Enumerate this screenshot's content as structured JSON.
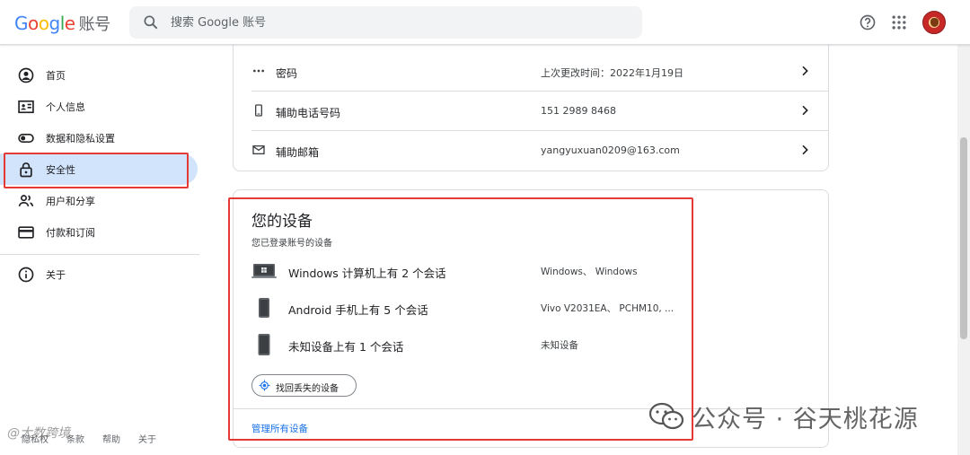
{
  "header": {
    "logo_letters": [
      "G",
      "o",
      "o",
      "g",
      "l",
      "e"
    ],
    "product": "账号",
    "search_placeholder": "搜索 Google 账号"
  },
  "sidebar": {
    "items": [
      {
        "label": "首页",
        "icon": "home-circle-icon"
      },
      {
        "label": "个人信息",
        "icon": "id-card-icon"
      },
      {
        "label": "数据和隐私设置",
        "icon": "toggle-icon"
      },
      {
        "label": "安全性",
        "icon": "lock-icon",
        "active": true
      },
      {
        "label": "用户和分享",
        "icon": "people-icon"
      },
      {
        "label": "付款和订阅",
        "icon": "credit-card-icon"
      },
      {
        "label": "关于",
        "icon": "info-icon"
      }
    ],
    "footer": [
      "隐私权",
      "条款",
      "帮助",
      "关于"
    ]
  },
  "security_rows": [
    {
      "icon": "password-dots-icon",
      "title": "密码",
      "value": "上次更改时间：2022年1月19日"
    },
    {
      "icon": "phone-icon",
      "title": "辅助电话号码",
      "value": "151 2989 8468"
    },
    {
      "icon": "mail-icon",
      "title": "辅助邮箱",
      "value": "yangyuxuan0209@163.com"
    }
  ],
  "devices": {
    "title": "您的设备",
    "subtitle": "您已登录账号的设备",
    "items": [
      {
        "icon": "windows-laptop-icon",
        "title": "Windows 计算机上有 2 个会话",
        "value": "Windows、 Windows"
      },
      {
        "icon": "android-phone-icon",
        "title": "Android 手机上有 5 个会话",
        "value": "Vivo V2031EA、 PCHM10, ..."
      },
      {
        "icon": "unknown-device-icon",
        "title": "未知设备上有 1 个会话",
        "value": "未知设备"
      }
    ],
    "find_button": "找回丢失的设备",
    "manage_link": "管理所有设备"
  },
  "watermark": {
    "text": "公众号 · 谷天桃花源",
    "secondary": "@大数跨境"
  },
  "colors": {
    "accent_blue": "#1a73e8",
    "active_nav_bg": "#d2e3fc",
    "highlight_red": "#e53935"
  }
}
